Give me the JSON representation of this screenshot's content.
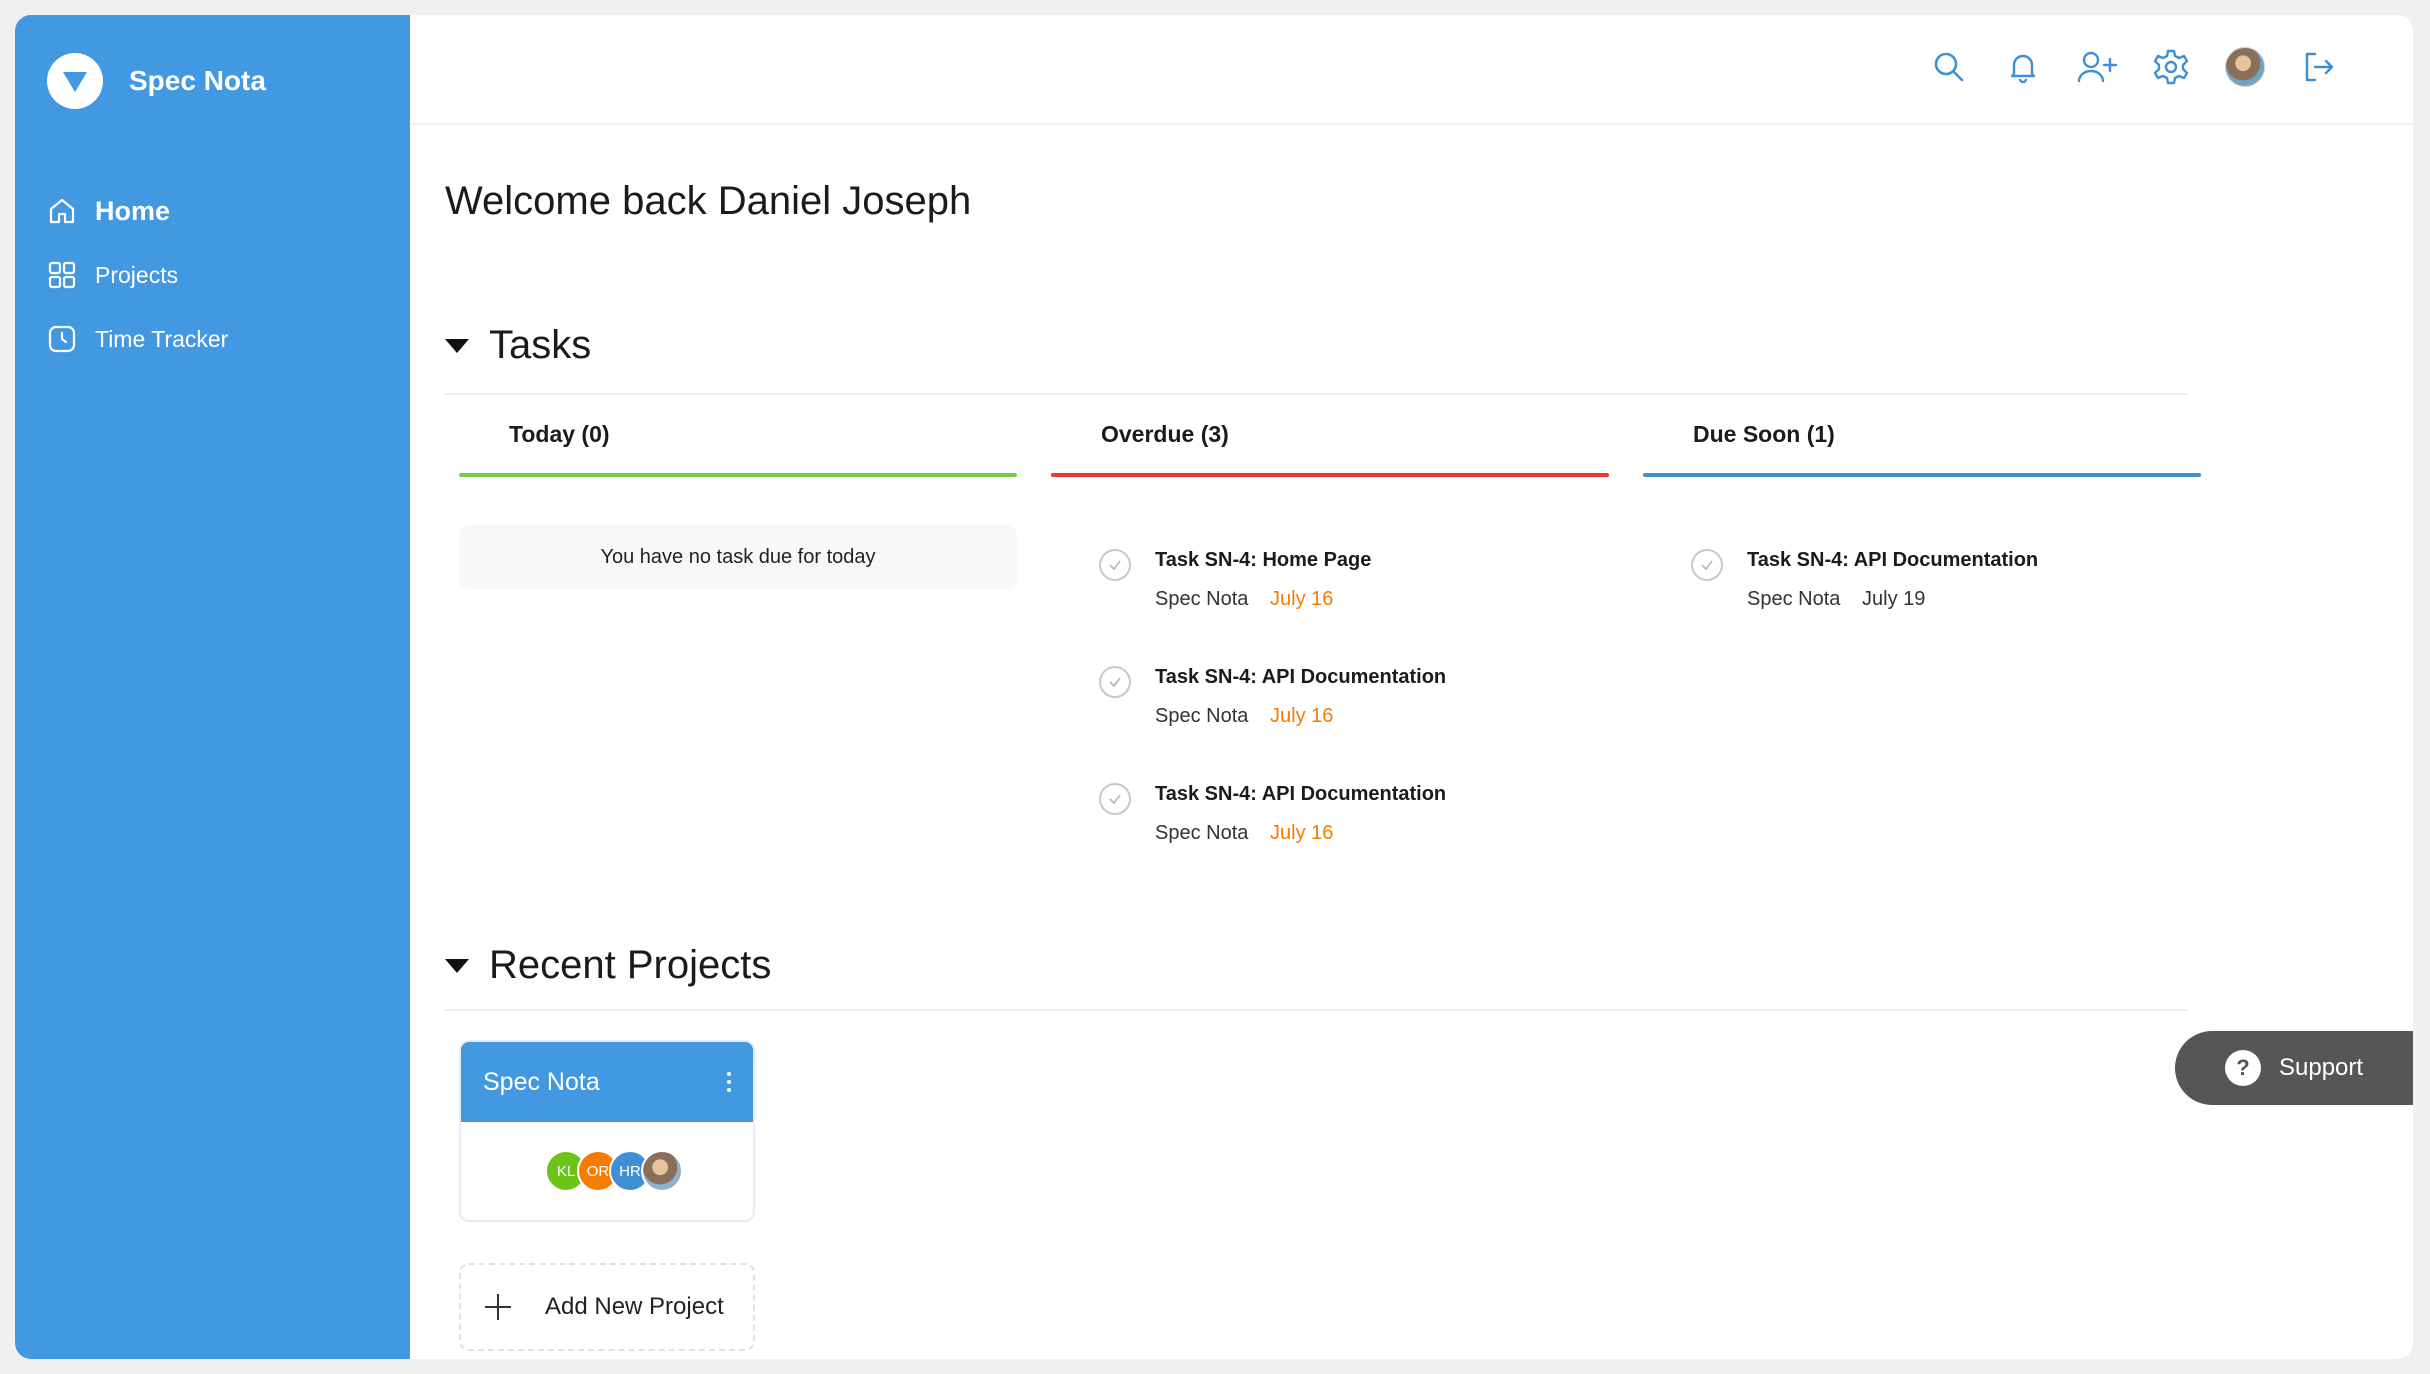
{
  "app": {
    "name": "Spec Nota"
  },
  "sidebar": {
    "items": [
      {
        "label": "Home",
        "icon": "home-icon",
        "active": true
      },
      {
        "label": "Projects",
        "icon": "grid-icon"
      },
      {
        "label": "Time Tracker",
        "icon": "clock-icon"
      }
    ]
  },
  "header": {
    "icons": [
      "search-icon",
      "bell-icon",
      "add-user-icon",
      "gear-icon",
      "avatar",
      "logout-icon"
    ]
  },
  "welcome": "Welcome back Daniel Joseph",
  "tasks": {
    "title": "Tasks",
    "tabs": [
      {
        "label": "Today (0)",
        "color": "#7ac943",
        "empty_text": "You have no task due for today",
        "items": []
      },
      {
        "label": "Overdue (3)",
        "color": "#e53935",
        "items": [
          {
            "title": "Task SN-4: Home Page",
            "project": "Spec Nota",
            "date": "July 16"
          },
          {
            "title": "Task SN-4: API Documentation",
            "project": "Spec Nota",
            "date": "July 16"
          },
          {
            "title": "Task SN-4: API Documentation",
            "project": "Spec Nota",
            "date": "July 16"
          }
        ]
      },
      {
        "label": "Due Soon (1)",
        "color": "#3f8fd4",
        "items": [
          {
            "title": "Task SN-4: API Documentation",
            "project": "Spec Nota",
            "date": "July 19"
          }
        ]
      }
    ],
    "overdue_date_color": "#f57c00"
  },
  "recent_projects": {
    "title": "Recent Projects",
    "cards": [
      {
        "name": "Spec Nota",
        "members": [
          {
            "initials": "KL",
            "color": "#6cc417"
          },
          {
            "initials": "OR",
            "color": "#f57c00"
          },
          {
            "initials": "HR",
            "color": "#3f8fd4"
          },
          {
            "initials": "",
            "color": "#8fb1c9"
          }
        ]
      }
    ],
    "add_label": "Add New Project"
  },
  "support": {
    "label": "Support",
    "icon_text": "?"
  }
}
